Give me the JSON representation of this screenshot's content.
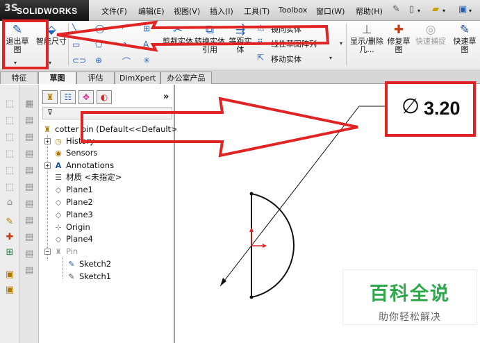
{
  "titlebar": {
    "brand": "SOLIDWORKS",
    "menus": [
      "文件(F)",
      "编辑(E)",
      "视图(V)",
      "插入(I)",
      "工具(T)",
      "Toolbox",
      "窗口(W)",
      "帮助(H)"
    ]
  },
  "ribbon": {
    "exit_sketch": "退出草图",
    "smart_dimension": "智能尺寸",
    "trim": "剪裁实体",
    "convert": "转换实体引用",
    "offset": "等距实体",
    "mirror": "镜向实体",
    "linear_pattern": "线性草图阵列",
    "move": "移动实体",
    "show_delete": "显示/删除几...",
    "repair": "修复草图",
    "quick_snap": "快速捕捉",
    "rapid_sketch": "快速草图"
  },
  "tabs": [
    "特征",
    "草图",
    "评估",
    "DimXpert",
    "办公室产品"
  ],
  "active_tab": "草图",
  "feature_tree": {
    "root": "cotter pin  (Default<<Default>",
    "items": [
      "History",
      "Sensors",
      "Annotations",
      "材质 <未指定>",
      "Plane1",
      "Plane2",
      "Plane3",
      "Origin",
      "Plane4",
      "Pin",
      "Sketch2",
      "Sketch1"
    ]
  },
  "callout": {
    "symbol": "∅",
    "value": "3.20"
  },
  "watermark": {
    "title": "百科全说",
    "subtitle": "助你轻松解决"
  },
  "icons": [
    "logo-icon",
    "exit-sketch-icon",
    "smart-dimension-icon",
    "filter-icon",
    "history-icon",
    "sensors-icon",
    "annotations-icon",
    "material-icon",
    "plane-icon",
    "origin-icon",
    "pin-icon",
    "sketch-icon"
  ]
}
